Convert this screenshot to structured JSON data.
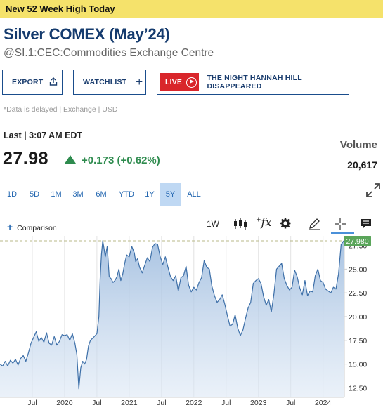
{
  "banner": {
    "text": "New 52 Week High Today"
  },
  "header": {
    "title": "Silver COMEX (May’24)",
    "subtitle": "@SI.1:CEC:Commodities Exchange Centre"
  },
  "buttons": {
    "export": "EXPORT",
    "watchlist": "WATCHLIST",
    "live_badge": "LIVE",
    "live_title": "THE NIGHT HANNAH HILL DISAPPEARED"
  },
  "delay_note": "*Data is delayed | Exchange | USD",
  "quote": {
    "last_label": "Last | 3:07 AM EDT",
    "price": "27.98",
    "change": "+0.173 (+0.62%)",
    "direction": "up",
    "volume_label": "Volume",
    "volume_value": "20,617"
  },
  "ranges": {
    "items": [
      "1D",
      "5D",
      "1M",
      "3M",
      "6M",
      "YTD",
      "1Y",
      "5Y",
      "ALL"
    ],
    "selected": "5Y"
  },
  "toolbar": {
    "comparison": "Comparison",
    "interval": "1W",
    "icons": [
      "candlestick-icon",
      "function-icon",
      "gear-icon",
      "pencil-icon",
      "crosshair-icon",
      "message-icon"
    ]
  },
  "colors": {
    "accent": "#2266b0",
    "up": "#2e8b4e",
    "live_red": "#d9262b",
    "banner": "#f5e26b",
    "line": "#3d6fa8",
    "last_price_tag": "#5aa55a"
  },
  "chart_data": {
    "type": "area",
    "ylim": [
      11.5,
      28.5
    ],
    "y_ticks": [
      12.5,
      15.0,
      17.5,
      20.0,
      22.5,
      25.0,
      27.5
    ],
    "y_tick_labels": [
      "12.50",
      "15.00",
      "17.50",
      "20.00",
      "22.50",
      "25.00",
      "27.50"
    ],
    "x_range": [
      2019.0,
      2024.33
    ],
    "x_ticks": [
      2019.5,
      2020.0,
      2020.5,
      2021.0,
      2021.5,
      2022.0,
      2022.5,
      2023.0,
      2023.5,
      2024.0
    ],
    "x_tick_labels": [
      "Jul",
      "2020",
      "Jul",
      "2021",
      "Jul",
      "2022",
      "Jul",
      "2023",
      "Jul",
      "2024"
    ],
    "last_value_label": "27.980",
    "series": [
      {
        "x": [
          2019.0,
          2019.04,
          2019.08,
          2019.12,
          2019.16,
          2019.2,
          2019.24,
          2019.28,
          2019.32,
          2019.36,
          2019.4,
          2019.44,
          2019.48,
          2019.52,
          2019.56,
          2019.6,
          2019.64,
          2019.68,
          2019.72,
          2019.76,
          2019.8,
          2019.84,
          2019.88,
          2019.92,
          2019.96,
          2020.0,
          2020.04,
          2020.08,
          2020.12,
          2020.16,
          2020.19,
          2020.22,
          2020.25,
          2020.28,
          2020.31,
          2020.34,
          2020.37,
          2020.4,
          2020.43,
          2020.46,
          2020.5,
          2020.53,
          2020.55,
          2020.57,
          2020.59,
          2020.61,
          2020.63,
          2020.66,
          2020.69,
          2020.72,
          2020.75,
          2020.78,
          2020.81,
          2020.84,
          2020.87,
          2020.9,
          2020.93,
          2020.96,
          2021.0,
          2021.04,
          2021.08,
          2021.1,
          2021.13,
          2021.16,
          2021.2,
          2021.24,
          2021.28,
          2021.32,
          2021.36,
          2021.4,
          2021.44,
          2021.48,
          2021.52,
          2021.56,
          2021.6,
          2021.64,
          2021.68,
          2021.72,
          2021.76,
          2021.8,
          2021.84,
          2021.88,
          2021.92,
          2021.96,
          2022.0,
          2022.04,
          2022.08,
          2022.12,
          2022.16,
          2022.2,
          2022.24,
          2022.28,
          2022.32,
          2022.36,
          2022.4,
          2022.44,
          2022.48,
          2022.52,
          2022.56,
          2022.6,
          2022.64,
          2022.68,
          2022.72,
          2022.76,
          2022.8,
          2022.84,
          2022.88,
          2022.92,
          2022.96,
          2023.0,
          2023.04,
          2023.08,
          2023.12,
          2023.16,
          2023.2,
          2023.24,
          2023.28,
          2023.32,
          2023.36,
          2023.4,
          2023.44,
          2023.48,
          2023.52,
          2023.56,
          2023.6,
          2023.64,
          2023.68,
          2023.72,
          2023.76,
          2023.8,
          2023.84,
          2023.88,
          2023.92,
          2023.96,
          2024.0,
          2024.04,
          2024.08,
          2024.12,
          2024.16,
          2024.2,
          2024.24,
          2024.28,
          2024.32
        ],
        "y": [
          15.0,
          14.8,
          15.3,
          14.8,
          15.4,
          15.1,
          15.5,
          14.9,
          15.6,
          15.9,
          15.3,
          16.2,
          17.2,
          17.8,
          18.4,
          17.4,
          17.8,
          17.3,
          18.3,
          17.2,
          17.0,
          17.9,
          17.0,
          17.4,
          18.1,
          18.0,
          18.1,
          17.5,
          18.2,
          17.2,
          16.0,
          12.4,
          14.6,
          15.3,
          15.0,
          15.5,
          16.9,
          17.5,
          17.7,
          17.9,
          18.2,
          20.0,
          24.0,
          26.5,
          28.0,
          27.2,
          26.3,
          27.4,
          24.2,
          24.0,
          23.6,
          23.8,
          24.2,
          25.0,
          23.8,
          24.5,
          25.6,
          26.5,
          26.3,
          27.4,
          26.7,
          25.8,
          26.1,
          25.2,
          24.6,
          25.4,
          26.2,
          25.8,
          27.3,
          27.7,
          27.6,
          26.3,
          25.5,
          26.3,
          25.2,
          24.2,
          23.8,
          24.3,
          22.7,
          24.1,
          24.3,
          25.3,
          23.3,
          22.6,
          23.1,
          22.8,
          23.6,
          24.1,
          25.9,
          25.2,
          25.0,
          23.2,
          22.2,
          21.5,
          21.8,
          22.3,
          21.3,
          20.1,
          19.0,
          19.2,
          20.2,
          18.8,
          18.0,
          18.6,
          19.8,
          20.9,
          21.5,
          23.5,
          23.8,
          24.0,
          23.5,
          22.1,
          21.2,
          21.8,
          20.5,
          22.4,
          25.0,
          25.3,
          25.6,
          24.0,
          23.3,
          22.8,
          23.1,
          24.9,
          24.2,
          23.0,
          22.3,
          23.8,
          22.2,
          22.7,
          22.6,
          24.3,
          25.0,
          23.8,
          23.6,
          22.9,
          22.7,
          22.5,
          23.1,
          22.9,
          24.5,
          27.6,
          27.98
        ]
      }
    ]
  }
}
